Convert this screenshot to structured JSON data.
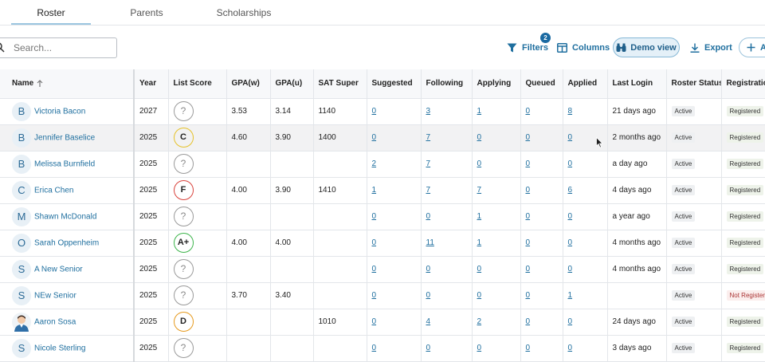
{
  "tabs": [
    {
      "label": "Roster",
      "active": true
    },
    {
      "label": "Parents",
      "active": false
    },
    {
      "label": "Scholarships",
      "active": false
    }
  ],
  "search": {
    "placeholder": "Search..."
  },
  "toolbar": {
    "filters_label": "Filters",
    "filters_count": "2",
    "columns_label": "Columns",
    "demo_view_label": "Demo view",
    "export_label": "Export",
    "add_label": "A"
  },
  "colors": {
    "link": "#1f6f9f",
    "badge": "#1a6aa2",
    "demo_bg": "#e4f0f8",
    "score_A_plus": "#3cb44b",
    "score_C": "#e6c229",
    "score_D": "#e69a1e",
    "score_F": "#d9433c",
    "score_unknown": "#9a9a9a"
  },
  "table": {
    "headers": [
      "Name",
      "Year",
      "List Score",
      "GPA(w)",
      "GPA(u)",
      "SAT Super",
      "Suggested",
      "Following",
      "Applying",
      "Queued",
      "Applied",
      "Last Login",
      "Roster Status",
      "Registration"
    ],
    "rows": [
      {
        "initial": "B",
        "name": "Victoria Bacon",
        "year": "2027",
        "score": "?",
        "gpa_w": "3.53",
        "gpa_u": "3.14",
        "sat": "1140",
        "suggested": "0",
        "following": "3",
        "applying": "1",
        "queued": "0",
        "applied": "8",
        "last_login": "21 days ago",
        "status": "Active",
        "registration": "Registered"
      },
      {
        "initial": "B",
        "name": "Jennifer Baselice",
        "year": "2025",
        "score": "C",
        "gpa_w": "4.60",
        "gpa_u": "3.90",
        "sat": "1400",
        "suggested": "0",
        "following": "7",
        "applying": "0",
        "queued": "0",
        "applied": "0",
        "last_login": "2 months ago",
        "status": "Active",
        "registration": "Registered"
      },
      {
        "initial": "B",
        "name": "Melissa Burnfield",
        "year": "2025",
        "score": "?",
        "gpa_w": "",
        "gpa_u": "",
        "sat": "",
        "suggested": "2",
        "following": "7",
        "applying": "0",
        "queued": "0",
        "applied": "0",
        "last_login": "a day ago",
        "status": "Active",
        "registration": "Registered"
      },
      {
        "initial": "C",
        "name": "Erica Chen",
        "year": "2025",
        "score": "F",
        "gpa_w": "4.00",
        "gpa_u": "3.90",
        "sat": "1410",
        "suggested": "1",
        "following": "7",
        "applying": "7",
        "queued": "0",
        "applied": "6",
        "last_login": "4 days ago",
        "status": "Active",
        "registration": "Registered"
      },
      {
        "initial": "M",
        "name": "Shawn McDonald",
        "year": "2025",
        "score": "?",
        "gpa_w": "",
        "gpa_u": "",
        "sat": "",
        "suggested": "0",
        "following": "0",
        "applying": "1",
        "queued": "0",
        "applied": "0",
        "last_login": "a year ago",
        "status": "Active",
        "registration": "Registered"
      },
      {
        "initial": "O",
        "name": "Sarah Oppenheim",
        "year": "2025",
        "score": "A+",
        "gpa_w": "4.00",
        "gpa_u": "4.00",
        "sat": "",
        "suggested": "0",
        "following": "11",
        "applying": "1",
        "queued": "0",
        "applied": "0",
        "last_login": "4 months ago",
        "status": "Active",
        "registration": "Registered"
      },
      {
        "initial": "S",
        "name": "A New Senior",
        "year": "2025",
        "score": "?",
        "gpa_w": "",
        "gpa_u": "",
        "sat": "",
        "suggested": "0",
        "following": "0",
        "applying": "0",
        "queued": "0",
        "applied": "0",
        "last_login": "4 months ago",
        "status": "Active",
        "registration": "Registered"
      },
      {
        "initial": "S",
        "name": "NEw Senior",
        "year": "2025",
        "score": "?",
        "gpa_w": "3.70",
        "gpa_u": "3.40",
        "sat": "",
        "suggested": "0",
        "following": "0",
        "applying": "0",
        "queued": "0",
        "applied": "1",
        "last_login": "",
        "status": "Active",
        "registration": "Not Registered"
      },
      {
        "initial": "",
        "photo": true,
        "name": "Aaron Sosa",
        "year": "2025",
        "score": "D",
        "gpa_w": "",
        "gpa_u": "",
        "sat": "1010",
        "suggested": "0",
        "following": "4",
        "applying": "2",
        "queued": "0",
        "applied": "0",
        "last_login": "24 days ago",
        "status": "Active",
        "registration": "Registered"
      },
      {
        "initial": "S",
        "name": "Nicole Sterling",
        "year": "2025",
        "score": "?",
        "gpa_w": "",
        "gpa_u": "",
        "sat": "",
        "suggested": "0",
        "following": "0",
        "applying": "0",
        "queued": "0",
        "applied": "0",
        "last_login": "3 days ago",
        "status": "Active",
        "registration": "Registered"
      }
    ]
  }
}
